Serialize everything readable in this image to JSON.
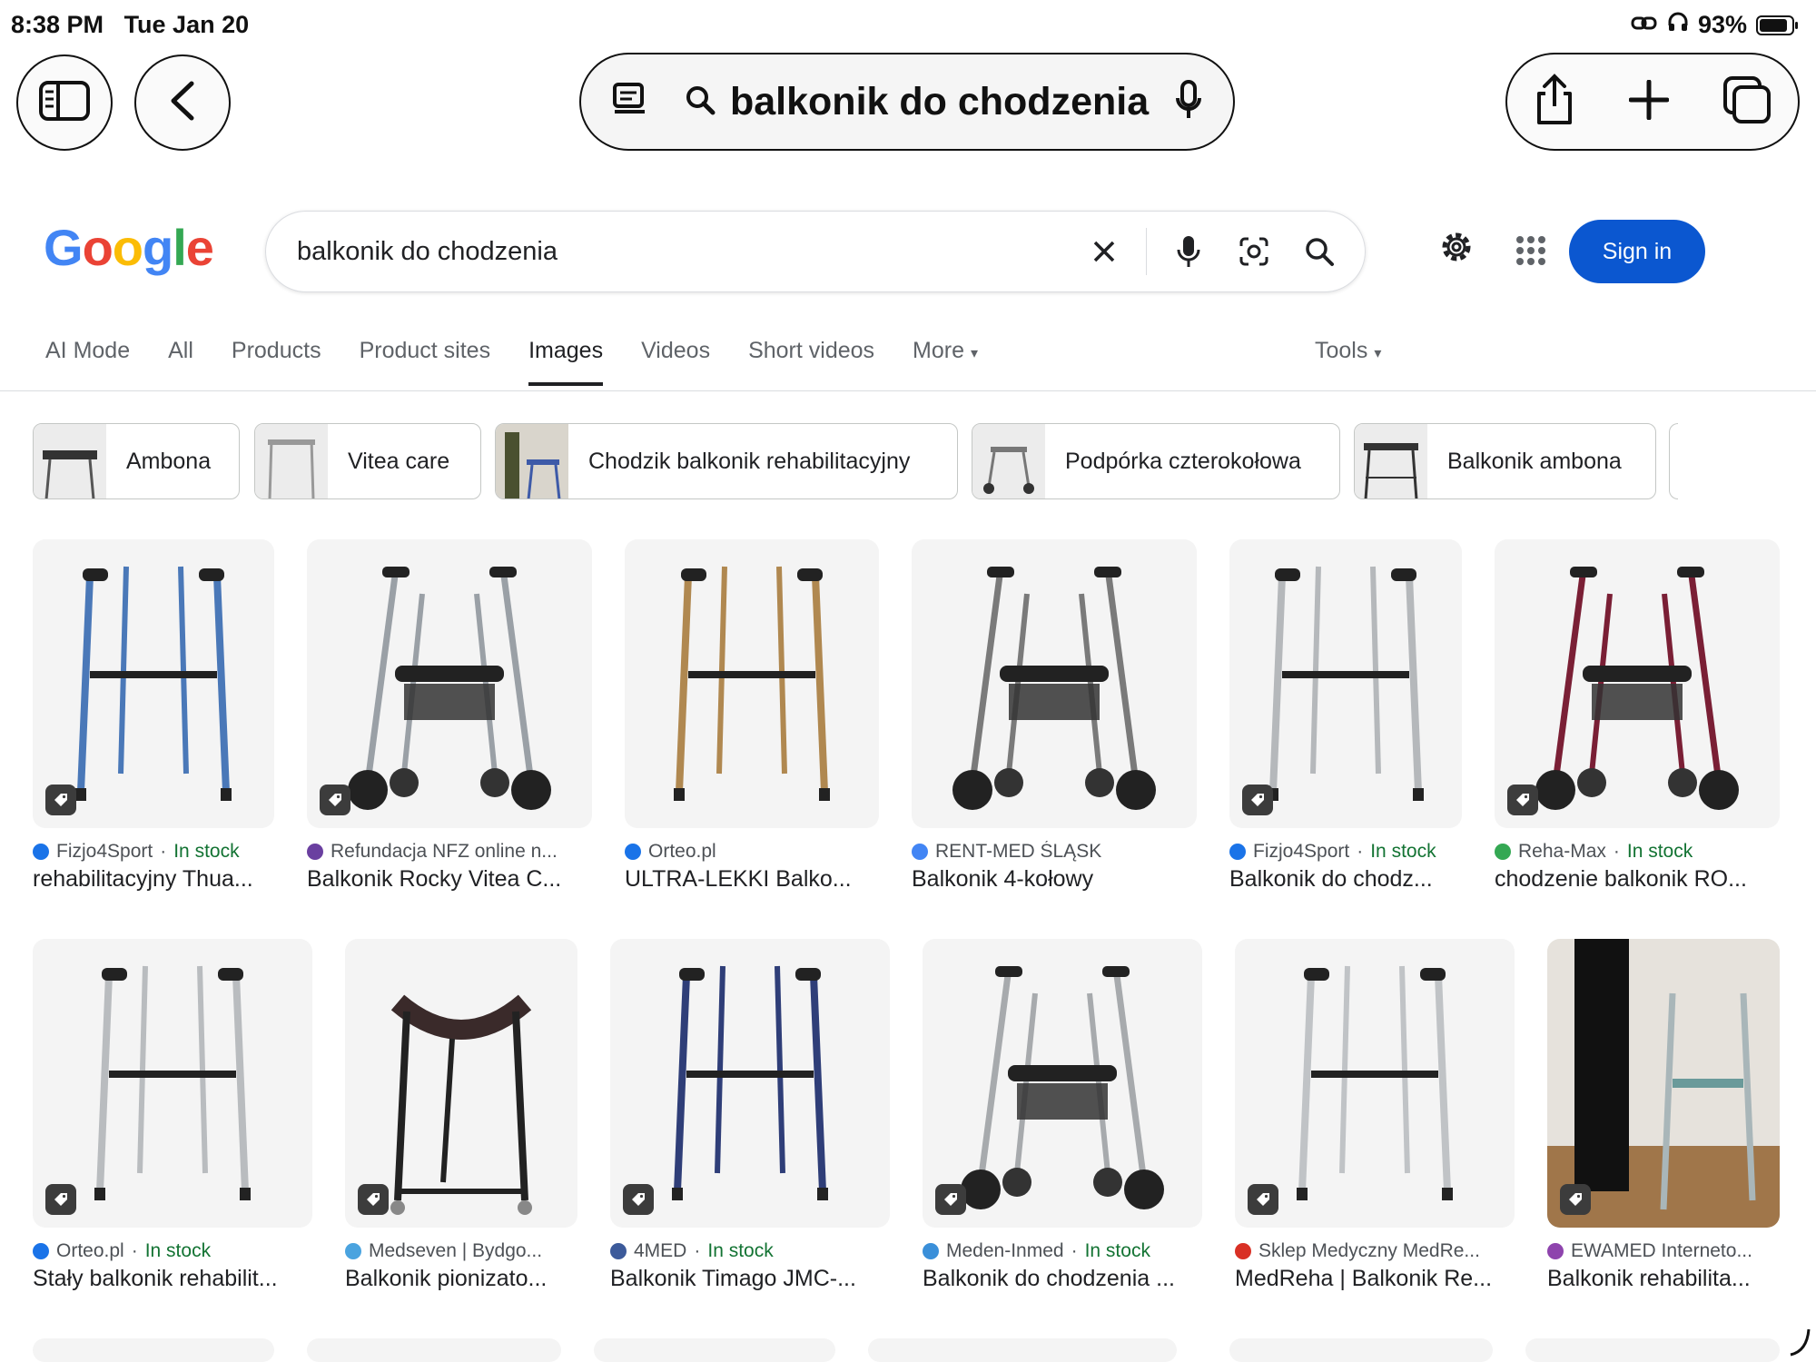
{
  "status": {
    "time": "8:38 PM",
    "date": "Tue Jan 20",
    "battery": "93%",
    "battery_level": 0.93
  },
  "safari": {
    "url_text": "balkonik do chodzenia"
  },
  "google": {
    "logo": [
      "G",
      "o",
      "o",
      "g",
      "l",
      "e"
    ],
    "query": "balkonik do chodzenia",
    "sign_in": "Sign in",
    "tabs": [
      "AI Mode",
      "All",
      "Products",
      "Product sites",
      "Images",
      "Videos",
      "Short videos",
      "More"
    ],
    "active_tab": "Images",
    "tools": "Tools"
  },
  "chips": [
    "Ambona",
    "Vitea care",
    "Chodzik balkonik rehabilitacyjny",
    "Podpórka czterokołowa",
    "Balkonik ambona"
  ],
  "results": [
    {
      "source": "Fizjo4Sport",
      "stock": "In stock",
      "title": "rehabilitacyjny Thua...",
      "favicon": "#1a73e8",
      "frame": "#4a78b8",
      "kind": "walker"
    },
    {
      "source": "Refundacja NFZ online n...",
      "stock": "",
      "title": "Balkonik Rocky Vitea C...",
      "favicon": "#6a3fa0",
      "frame": "#9aa0a6",
      "kind": "rollator"
    },
    {
      "source": "Orteo.pl",
      "stock": "",
      "title": "ULTRA-LEKKI Balko...",
      "favicon": "#1a73e8",
      "frame": "#b08850",
      "kind": "walker"
    },
    {
      "source": "RENT-MED ŚLĄSK",
      "stock": "",
      "title": "Balkonik 4-kołowy",
      "favicon": "#4285f4",
      "frame": "#7a7a7a",
      "kind": "rollator"
    },
    {
      "source": "Fizjo4Sport",
      "stock": "In stock",
      "title": "Balkonik do chodz...",
      "favicon": "#1a73e8",
      "frame": "#b5b8bb",
      "kind": "walker"
    },
    {
      "source": "Reha-Max",
      "stock": "In stock",
      "title": "chodzenie balkonik RO...",
      "favicon": "#34a853",
      "frame": "#7a1f35",
      "kind": "rollator"
    },
    {
      "source": "Orteo.pl",
      "stock": "In stock",
      "title": "Stały balkonik rehabilit...",
      "favicon": "#1a73e8",
      "frame": "#b9bcbf",
      "kind": "walker"
    },
    {
      "source": "Medseven | Bydgo...",
      "stock": "",
      "title": "Balkonik pionizato...",
      "favicon": "#4aa3df",
      "frame": "#222222",
      "kind": "stander"
    },
    {
      "source": "4MED",
      "stock": "In stock",
      "title": "Balkonik Timago JMC-...",
      "favicon": "#3c5a9a",
      "frame": "#2f3e78",
      "kind": "walker"
    },
    {
      "source": "Meden-Inmed",
      "stock": "In stock",
      "title": "Balkonik do chodzenia ...",
      "favicon": "#3a8fd9",
      "frame": "#a7aaad",
      "kind": "rollator"
    },
    {
      "source": "Sklep Medyczny MedRe...",
      "stock": "",
      "title": "MedReha | Balkonik Re...",
      "favicon": "#d93025",
      "frame": "#c0c3c6",
      "kind": "walker"
    },
    {
      "source": "EWAMED Interneto...",
      "stock": "",
      "title": "Balkonik rehabilita...",
      "favicon": "#8e44ad",
      "frame": "#a9b6b9",
      "kind": "photo"
    }
  ]
}
